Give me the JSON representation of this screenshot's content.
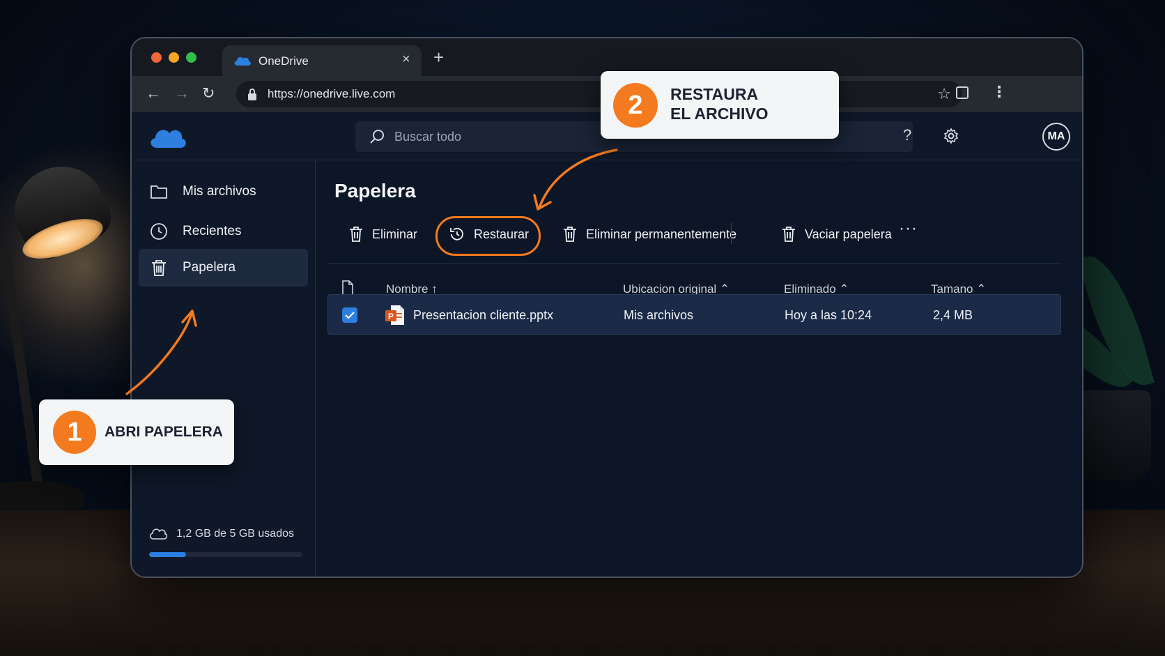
{
  "browser": {
    "tab_title": "OneDrive",
    "tab_close": "×",
    "new_tab": "+",
    "url": "https://onedrive.live.com"
  },
  "app": {
    "search_placeholder": "Buscar todo",
    "help_label": "?",
    "avatar_initials": "MA"
  },
  "sidebar": {
    "items": [
      {
        "label": "Mis archivos",
        "icon": "folder-icon"
      },
      {
        "label": "Recientes",
        "icon": "clock-icon"
      },
      {
        "label": "Papelera",
        "icon": "trash-icon",
        "active": true
      }
    ],
    "storage_text": "1,2 GB de 5 GB usados",
    "storage_used_fraction": 0.24
  },
  "main": {
    "title": "Papelera",
    "toolbar": {
      "delete_label": "Eliminar",
      "restore_label": "Restaurar",
      "delete_permanent_label": "Eliminar permanentemente",
      "empty_trash_label": "Vaciar papelera",
      "more_label": "···"
    },
    "columns": {
      "name": "Nombre ↑",
      "original_location": "Ubicacion original ⌃",
      "deleted": "Eliminado ⌃",
      "size": "Tamano ⌃"
    },
    "rows": [
      {
        "name": "Presentacion cliente.pptx",
        "original_location": "Mis archivos",
        "deleted": "Hoy a las 10:24",
        "size": "2,4 MB",
        "selected": true
      }
    ]
  },
  "callouts": {
    "step1_number": "1",
    "step1_text": "ABRI PAPELERA",
    "step2_number": "2",
    "step2_line1": "RESTAURA",
    "step2_line2": "EL ARCHIVO"
  },
  "colors": {
    "accent_orange": "#f47a1f",
    "accent_blue": "#2d7fe0",
    "bg_app": "#0d1626"
  }
}
